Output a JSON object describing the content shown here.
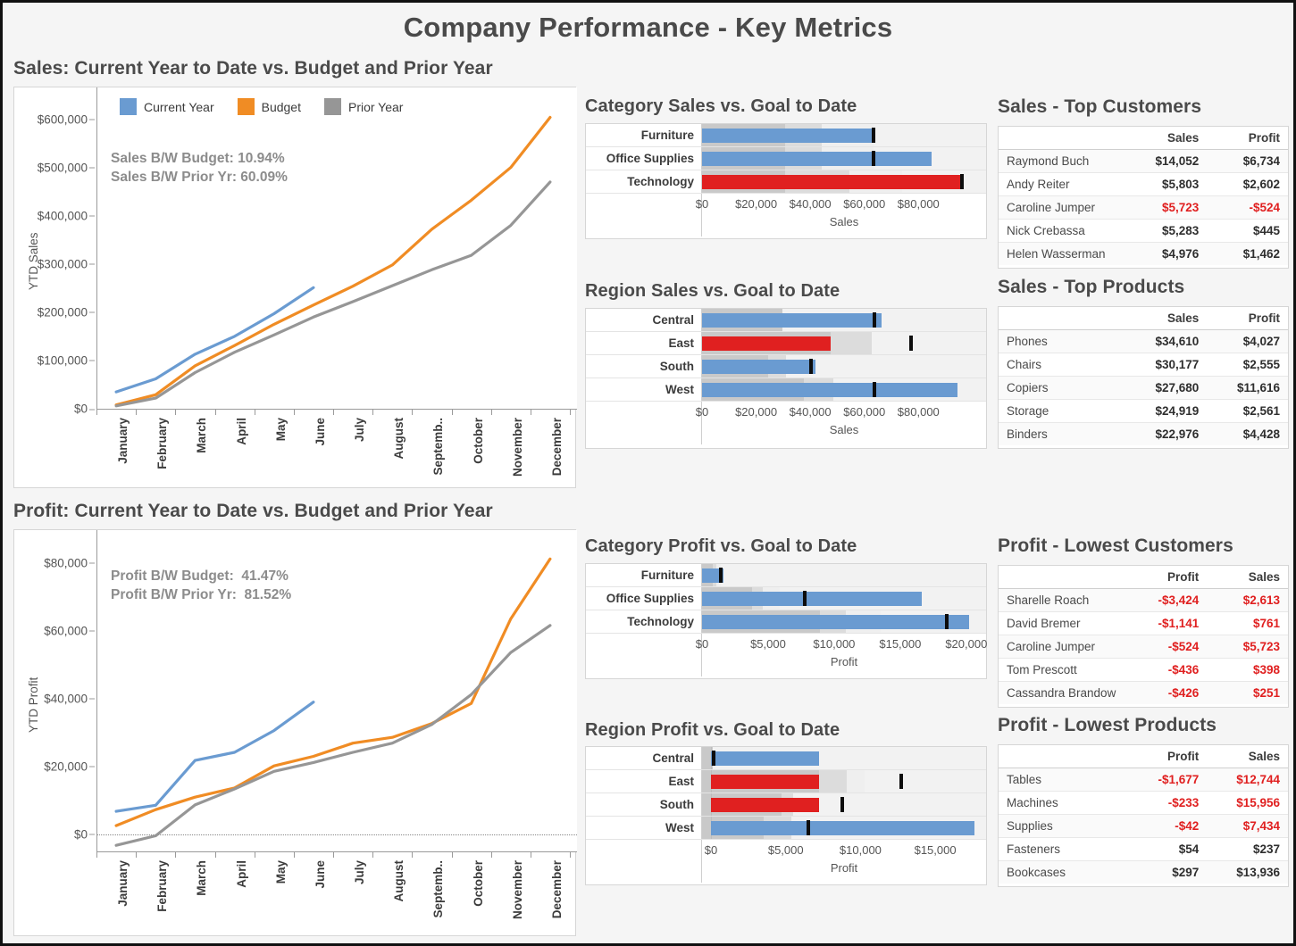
{
  "dashboard": {
    "title": "Company Performance - Key Metrics"
  },
  "sales_line": {
    "panel_title": "Sales: Current Year to Date vs. Budget and Prior Year",
    "ylabel": "YTD Sales",
    "annotation_line1": "Sales B/W Budget: 10.94%",
    "annotation_line2": "Sales B/W Prior Yr: 60.09%",
    "legend": [
      {
        "label": "Current Year",
        "color": "#6a9bd1"
      },
      {
        "label": "Budget",
        "color": "#f08c24"
      },
      {
        "label": "Prior Year",
        "color": "#969696"
      }
    ]
  },
  "profit_line": {
    "panel_title": "Profit: Current Year to Date vs. Budget and Prior Year",
    "ylabel": "YTD Profit",
    "annotation_line1": "Profit B/W Budget:  41.47%",
    "annotation_line2": "Profit B/W Prior Yr:  81.52%"
  },
  "category_sales": {
    "title": "Category Sales vs. Goal to Date",
    "axis_title": "Sales",
    "rows": [
      {
        "label": "Furniture",
        "value": 63800,
        "target": 63300,
        "status": "ok",
        "bands": [
          30800,
          44300,
          63300
        ]
      },
      {
        "label": "Office Supplies",
        "value": 85000,
        "target": 63300,
        "status": "ok",
        "bands": [
          30800,
          44300,
          63300
        ]
      },
      {
        "label": "Technology",
        "value": 96600,
        "target": 96000,
        "status": "bad",
        "bands": [
          30800,
          54500,
          74000
        ]
      }
    ],
    "ticks": [
      "$0",
      "$20,000",
      "$40,000",
      "$60,000",
      "$80,000"
    ],
    "tick_values": [
      0,
      20000,
      40000,
      60000,
      80000
    ],
    "axis_max": 105000
  },
  "region_sales": {
    "title": "Region Sales vs. Goal to Date",
    "axis_title": "Sales",
    "rows": [
      {
        "label": "Central",
        "value": 66500,
        "target": 63800,
        "status": "ok",
        "bands": [
          29800,
          29800,
          29800
        ]
      },
      {
        "label": "East",
        "value": 47600,
        "target": 77300,
        "status": "bad",
        "bands": [
          47600,
          62600,
          62600
        ]
      },
      {
        "label": "South",
        "value": 42000,
        "target": 40300,
        "status": "ok",
        "bands": [
          24500,
          31200,
          31200
        ]
      },
      {
        "label": "West",
        "value": 94300,
        "target": 63800,
        "status": "ok",
        "bands": [
          37500,
          48500,
          48500
        ]
      }
    ],
    "ticks": [
      "$0",
      "$20,000",
      "$40,000",
      "$60,000",
      "$80,000"
    ],
    "tick_values": [
      0,
      20000,
      40000,
      60000,
      80000
    ],
    "axis_max": 105000
  },
  "category_profit": {
    "title": "Category Profit vs. Goal to Date",
    "axis_title": "Profit",
    "rows": [
      {
        "label": "Furniture",
        "value": 1600,
        "target": 1450,
        "status": "ok",
        "bands": [
          800,
          1100,
          1400
        ]
      },
      {
        "label": "Office Supplies",
        "value": 16600,
        "target": 7800,
        "status": "ok",
        "bands": [
          3800,
          4600,
          5900
        ]
      },
      {
        "label": "Technology",
        "value": 20200,
        "target": 18500,
        "status": "ok",
        "bands": [
          8900,
          10900,
          13500
        ]
      }
    ],
    "ticks": [
      "$0",
      "$5,000",
      "$10,000",
      "$15,000",
      "$20,000"
    ],
    "tick_values": [
      0,
      5000,
      10000,
      15000,
      20000
    ],
    "axis_max": 21500
  },
  "region_profit": {
    "title": "Region Profit vs. Goal to Date",
    "axis_title": "Profit",
    "rows": [
      {
        "label": "Central",
        "value": 7200,
        "target": 200,
        "status": "ok",
        "bands": [
          100,
          100,
          100
        ]
      },
      {
        "label": "East",
        "value": 7200,
        "target": 12700,
        "status": "bad",
        "bands": [
          7200,
          9100,
          10300
        ]
      },
      {
        "label": "South",
        "value": 7200,
        "target": 8800,
        "status": "bad",
        "bands": [
          4700,
          5500,
          5500
        ]
      },
      {
        "label": "West",
        "value": 17600,
        "target": 6500,
        "status": "ok",
        "bands": [
          3500,
          5400,
          5400
        ]
      }
    ],
    "ticks": [
      "$0",
      "$5,000",
      "$10,000",
      "$15,000"
    ],
    "tick_values": [
      0,
      5000,
      10000,
      15000
    ],
    "axis_min": -600,
    "axis_max": 18400
  },
  "top_customers": {
    "title": "Sales - Top Customers",
    "columns": [
      "",
      "Sales",
      "Profit"
    ],
    "rows": [
      {
        "name": "Raymond Buch",
        "c1": "$14,052",
        "c2": "$6,734",
        "red": false
      },
      {
        "name": "Andy Reiter",
        "c1": "$5,803",
        "c2": "$2,602",
        "red": false
      },
      {
        "name": "Caroline Jumper",
        "c1": "$5,723",
        "c2": "-$524",
        "red": true
      },
      {
        "name": "Nick Crebassa",
        "c1": "$5,283",
        "c2": "$445",
        "red": false
      },
      {
        "name": "Helen Wasserman",
        "c1": "$4,976",
        "c2": "$1,462",
        "red": false
      }
    ]
  },
  "top_products": {
    "title": "Sales - Top Products",
    "columns": [
      "",
      "Sales",
      "Profit"
    ],
    "rows": [
      {
        "name": "Phones",
        "c1": "$34,610",
        "c2": "$4,027",
        "red": false
      },
      {
        "name": "Chairs",
        "c1": "$30,177",
        "c2": "$2,555",
        "red": false
      },
      {
        "name": "Copiers",
        "c1": "$27,680",
        "c2": "$11,616",
        "red": false
      },
      {
        "name": "Storage",
        "c1": "$24,919",
        "c2": "$2,561",
        "red": false
      },
      {
        "name": "Binders",
        "c1": "$22,976",
        "c2": "$4,428",
        "red": false
      }
    ]
  },
  "lowest_customers": {
    "title": "Profit - Lowest Customers",
    "columns": [
      "",
      "Profit",
      "Sales"
    ],
    "rows": [
      {
        "name": "Sharelle Roach",
        "c1": "-$3,424",
        "c2": "$2,613",
        "red": true
      },
      {
        "name": "David Bremer",
        "c1": "-$1,141",
        "c2": "$761",
        "red": true
      },
      {
        "name": "Caroline Jumper",
        "c1": "-$524",
        "c2": "$5,723",
        "red": true
      },
      {
        "name": "Tom Prescott",
        "c1": "-$436",
        "c2": "$398",
        "red": true
      },
      {
        "name": "Cassandra Brandow",
        "c1": "-$426",
        "c2": "$251",
        "red": true
      }
    ]
  },
  "lowest_products": {
    "title": "Profit - Lowest Products",
    "columns": [
      "",
      "Profit",
      "Sales"
    ],
    "rows": [
      {
        "name": "Tables",
        "c1": "-$1,677",
        "c2": "$12,744",
        "red": true
      },
      {
        "name": "Machines",
        "c1": "-$233",
        "c2": "$15,956",
        "red": true
      },
      {
        "name": "Supplies",
        "c1": "-$42",
        "c2": "$7,434",
        "red": true
      },
      {
        "name": "Fasteners",
        "c1": "$54",
        "c2": "$237",
        "red": false
      },
      {
        "name": "Bookcases",
        "c1": "$297",
        "c2": "$13,936",
        "red": false
      }
    ]
  },
  "chart_data": [
    {
      "type": "line",
      "title": "Sales: Current Year to Date vs. Budget and Prior Year",
      "xlabel": "",
      "ylabel": "YTD Sales",
      "categories": [
        "January",
        "February",
        "March",
        "April",
        "May",
        "June",
        "July",
        "August",
        "Septemb..",
        "October",
        "November",
        "December"
      ],
      "ytick_labels": [
        "$0",
        "$100,000",
        "$200,000",
        "$300,000",
        "$400,000",
        "$500,000",
        "$600,000"
      ],
      "ylim": [
        0,
        640000
      ],
      "grid": false,
      "legend_position": "top-left",
      "series": [
        {
          "name": "Current Year",
          "color": "#6a9bd1",
          "values": [
            35000,
            62000,
            113000,
            150000,
            197000,
            251000,
            null,
            null,
            null,
            null,
            null,
            null
          ]
        },
        {
          "name": "Budget",
          "color": "#f08c24",
          "values": [
            8000,
            29000,
            89000,
            131000,
            175000,
            215000,
            254000,
            298000,
            372000,
            432000,
            500000,
            604000
          ]
        },
        {
          "name": "Prior Year",
          "color": "#969696",
          "values": [
            6000,
            22000,
            75000,
            117000,
            153000,
            190000,
            222000,
            255000,
            288000,
            318000,
            380000,
            470000
          ]
        }
      ]
    },
    {
      "type": "line",
      "title": "Profit: Current Year to Date vs. Budget and Prior Year",
      "xlabel": "",
      "ylabel": "YTD Profit",
      "categories": [
        "January",
        "February",
        "March",
        "April",
        "May",
        "June",
        "July",
        "August",
        "Septemb..",
        "October",
        "November",
        "December"
      ],
      "ytick_labels": [
        "$0",
        "$20,000",
        "$40,000",
        "$60,000",
        "$80,000"
      ],
      "ylim": [
        -5000,
        86000
      ],
      "grid": false,
      "zero_reference_line": true,
      "series": [
        {
          "name": "Current Year",
          "color": "#6a9bd1",
          "values": [
            6800,
            8600,
            21800,
            24200,
            30600,
            39000,
            null,
            null,
            null,
            null,
            null,
            null
          ]
        },
        {
          "name": "Budget",
          "color": "#f08c24",
          "values": [
            2600,
            7300,
            11000,
            13700,
            20200,
            23000,
            26900,
            28600,
            32700,
            38600,
            63500,
            81200
          ]
        },
        {
          "name": "Prior Year",
          "color": "#969696",
          "values": [
            -3200,
            -400,
            8700,
            13400,
            18600,
            21200,
            24200,
            26900,
            32400,
            41200,
            53600,
            61600
          ]
        }
      ]
    },
    {
      "type": "bar",
      "subtype": "bullet",
      "title": "Category Sales vs. Goal to Date",
      "xlabel": "Sales",
      "categories": [
        "Furniture",
        "Office Supplies",
        "Technology"
      ],
      "values": [
        63800,
        85000,
        96600
      ],
      "targets": [
        63300,
        63300,
        96000
      ],
      "xlim": [
        0,
        105000
      ]
    },
    {
      "type": "bar",
      "subtype": "bullet",
      "title": "Region Sales vs. Goal to Date",
      "xlabel": "Sales",
      "categories": [
        "Central",
        "East",
        "South",
        "West"
      ],
      "values": [
        66500,
        47600,
        42000,
        94300
      ],
      "targets": [
        63800,
        77300,
        40300,
        63800
      ],
      "xlim": [
        0,
        105000
      ]
    },
    {
      "type": "bar",
      "subtype": "bullet",
      "title": "Category Profit vs. Goal to Date",
      "xlabel": "Profit",
      "categories": [
        "Furniture",
        "Office Supplies",
        "Technology"
      ],
      "values": [
        1600,
        16600,
        20200
      ],
      "targets": [
        1450,
        7800,
        18500
      ],
      "xlim": [
        0,
        21500
      ]
    },
    {
      "type": "bar",
      "subtype": "bullet",
      "title": "Region Profit vs. Goal to Date",
      "xlabel": "Profit",
      "categories": [
        "Central",
        "East",
        "South",
        "West"
      ],
      "values": [
        7200,
        7200,
        7200,
        17600
      ],
      "targets": [
        200,
        12700,
        8800,
        6500
      ],
      "xlim": [
        -600,
        18400
      ]
    }
  ]
}
